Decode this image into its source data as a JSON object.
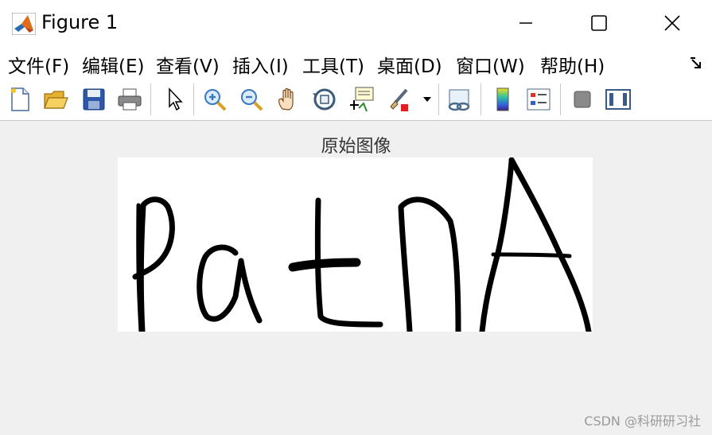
{
  "window": {
    "title": "Figure 1",
    "controls": [
      "minimize-icon",
      "maximize-icon",
      "close-icon"
    ]
  },
  "menu": {
    "items": [
      "文件(F)",
      "编辑(E)",
      "查看(V)",
      "插入(I)",
      "工具(T)",
      "桌面(D)",
      "窗口(W)",
      "帮助(H)"
    ]
  },
  "toolbar": {
    "buttons": [
      "new-figure-icon",
      "open-file-icon",
      "save-icon",
      "print-icon",
      "edit-plot-pointer-icon",
      "zoom-in-icon",
      "zoom-out-icon",
      "pan-hand-icon",
      "rotate-3d-icon",
      "data-cursor-icon",
      "brush-icon",
      "brush-dropdown-icon",
      "link-plot-icon",
      "colorbar-icon",
      "legend-icon",
      "hide-plot-tools-icon",
      "show-plot-tools-icon"
    ]
  },
  "axes": {
    "title": "原始图像",
    "image_content": "handwritten strokes"
  },
  "watermark": "CSDN @科研研习社",
  "colors": {
    "titlebar_bg": "#ffffff",
    "figure_bg": "#f0f0f0",
    "stroke": "#000000"
  }
}
